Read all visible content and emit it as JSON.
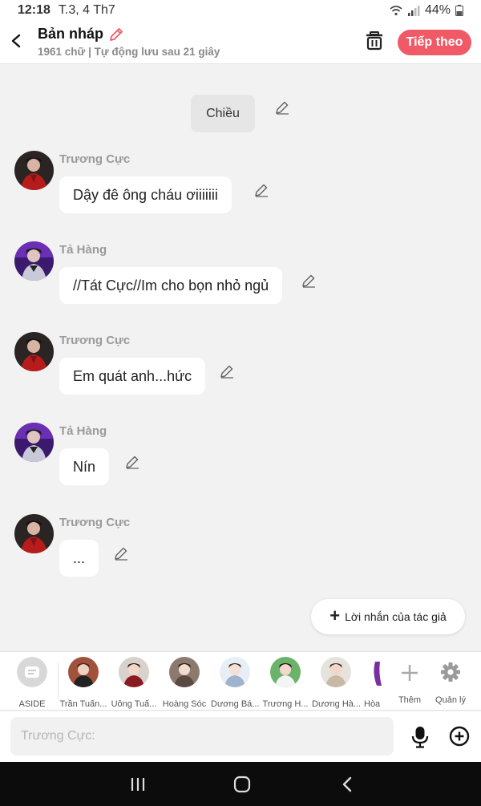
{
  "status": {
    "time": "12:18",
    "date": "T.3, 4 Th7",
    "battery": "44%"
  },
  "header": {
    "title": "Bản nháp",
    "subtitle": "1961 chữ | Tự động lưu sau 21 giây",
    "next_label": "Tiếp theo"
  },
  "chat": {
    "time_chip": "Chiều",
    "messages": [
      {
        "name": "Trương Cực",
        "text": "Dậy đê ông cháu ơiiiiiii"
      },
      {
        "name": "Tả Hàng",
        "text": "//Tát Cực//Im cho bọn nhỏ ngủ"
      },
      {
        "name": "Trương Cực",
        "text": "Em quát anh...hức"
      },
      {
        "name": "Tả Hàng",
        "text": "Nín"
      },
      {
        "name": "Trương Cực",
        "text": "..."
      }
    ],
    "author_note": "Lời nhắn của tác giả"
  },
  "characters": [
    {
      "label": "ASIDE"
    },
    {
      "label": "Trần Tuấn..."
    },
    {
      "label": "Uông Tuấ..."
    },
    {
      "label": "Hoàng Sóc"
    },
    {
      "label": "Dương Bá..."
    },
    {
      "label": "Trương H..."
    },
    {
      "label": "Dương Hà..."
    },
    {
      "label": "Hòa"
    }
  ],
  "char_actions": {
    "more": "Thêm",
    "manage": "Quản lý"
  },
  "input": {
    "placeholder": "Trương Cực:"
  },
  "colors": {
    "accent": "#f05a66",
    "bubble": "#ffffff",
    "background": "#f2f2f2"
  }
}
